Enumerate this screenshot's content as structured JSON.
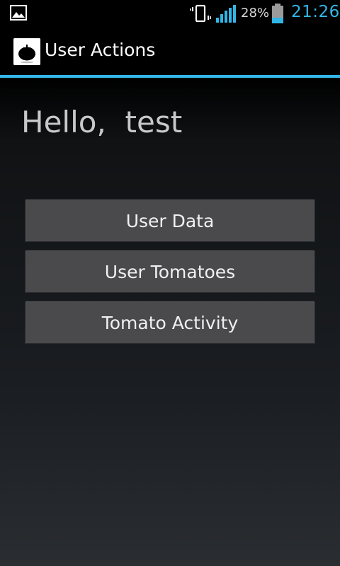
{
  "status_bar": {
    "left_icon": "image-notification-icon",
    "vibrate_icon": "vibrate-icon",
    "signal_icon": "signal-icon",
    "battery_percent": "28%",
    "battery_level": 0.28,
    "time": "21:26",
    "colors": {
      "clock": "#33b5e5",
      "signal": "#33b5e5"
    }
  },
  "action_bar": {
    "icon": "tomato-icon",
    "title": "User Actions",
    "accent_color": "#33b5e5"
  },
  "main": {
    "greeting": "Hello,  test",
    "buttons": [
      {
        "label": "User Data"
      },
      {
        "label": "User Tomatoes"
      },
      {
        "label": "Tomato Activity"
      }
    ]
  }
}
